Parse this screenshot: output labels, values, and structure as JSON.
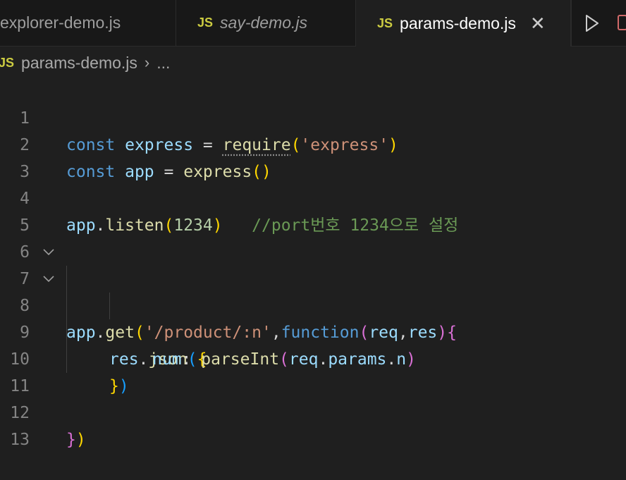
{
  "tabs": [
    {
      "name": "explorer-demo.js",
      "icon": "js-icon",
      "active": false
    },
    {
      "name": "say-demo.js",
      "icon": "js-icon",
      "active": false,
      "italic": true
    },
    {
      "name": "params-demo.js",
      "icon": "js-icon",
      "active": true
    }
  ],
  "tab_icon_text": "JS",
  "close_glyph": "✕",
  "breadcrumb": {
    "file": "params-demo.js",
    "more": "..."
  },
  "line_numbers": [
    "1",
    "2",
    "3",
    "4",
    "5",
    "6",
    "7",
    "8",
    "9",
    "10",
    "11",
    "12",
    "13"
  ],
  "code": {
    "l1": {
      "kw": "const",
      "var": "express",
      "op": "=",
      "fn": "require",
      "open": "(",
      "str": "'express'",
      "close": ")"
    },
    "l2": {
      "kw": "const",
      "var": "app",
      "op": "=",
      "fn": "express",
      "parens": "()"
    },
    "l4": {
      "obj": "app",
      "dot": ".",
      "fn": "listen",
      "open": "(",
      "num": "1234",
      "close": ")",
      "comment": "//port번호 1234으로 설정"
    },
    "l7": {
      "obj": "app",
      "dot": ".",
      "fn": "get",
      "open": "(",
      "str": "'/product/:n'",
      "comma": ",",
      "kw": "function",
      "open2": "(",
      "p1": "req",
      "comma2": ",",
      "p2": "res",
      "close2": ")",
      "brace": "{"
    },
    "l8": {
      "obj": "res",
      "dot": ".",
      "fn": "json",
      "open": "(",
      "brace": "{"
    },
    "l9": {
      "key": "num",
      "colon": ":",
      "fn": "parseInt",
      "open": "(",
      "obj": "req",
      "dot1": ".",
      "prop": "params",
      "dot2": ".",
      "prop2": "n",
      "close": ")"
    },
    "l10": {
      "brace": "}",
      "close": ")"
    },
    "l12": {
      "brace": "}",
      "close": ")"
    }
  },
  "colors": {
    "keyword": "#569cd6",
    "variable": "#9cdcfe",
    "function": "#dcdcaa",
    "string": "#ce9178",
    "number": "#b5cea8",
    "comment": "#6a9955"
  }
}
